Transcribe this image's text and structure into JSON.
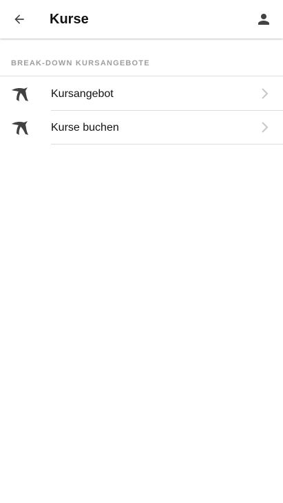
{
  "header": {
    "title": "Kurse",
    "back_icon": "arrow-back-icon",
    "account_icon": "person-icon"
  },
  "section": {
    "title": "BREAK-DOWN KURSANGEBOTE"
  },
  "items": [
    {
      "label": "Kursangebot",
      "icon": "swallow-logo-icon",
      "chevron": "chevron-right-icon"
    },
    {
      "label": "Kurse buchen",
      "icon": "swallow-logo-icon",
      "chevron": "chevron-right-icon"
    }
  ],
  "colors": {
    "title": "#111111",
    "section_header": "#9e9e9e",
    "divider": "#dcdcdc",
    "icon": "#424242",
    "chevron": "#c7c7c7"
  }
}
